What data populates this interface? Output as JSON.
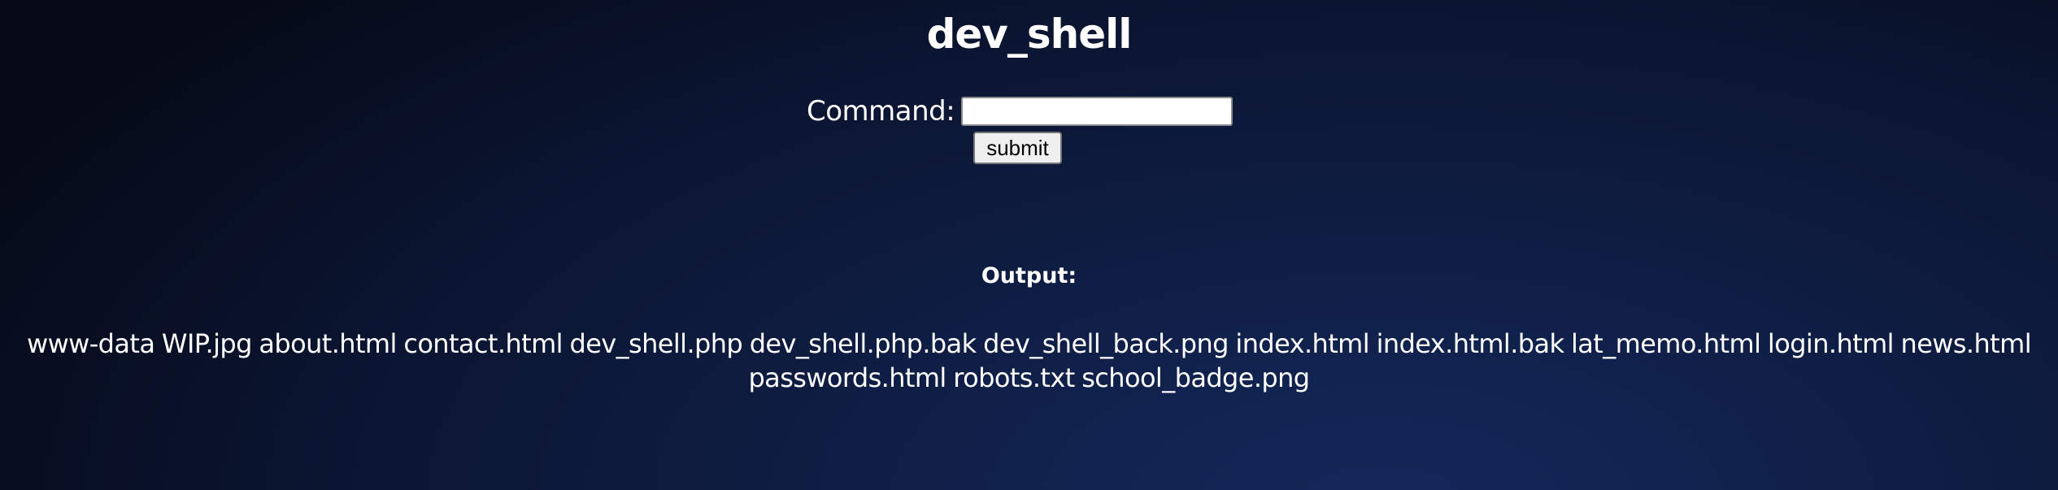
{
  "page": {
    "title": "dev_shell"
  },
  "form": {
    "command_label": "Command:",
    "command_value": "",
    "submit_label": "submit"
  },
  "output": {
    "heading": "Output:",
    "text": "www-data WIP.jpg about.html contact.html dev_shell.php dev_shell.php.bak dev_shell_back.png index.html index.html.bak lat_memo.html login.html news.html passwords.html robots.txt school_badge.png"
  },
  "colors": {
    "background_dark": "#060a18",
    "background_mid": "#0f1d43",
    "background_light": "#13285a",
    "text": "#ffffff",
    "button_bg": "#efefef"
  }
}
